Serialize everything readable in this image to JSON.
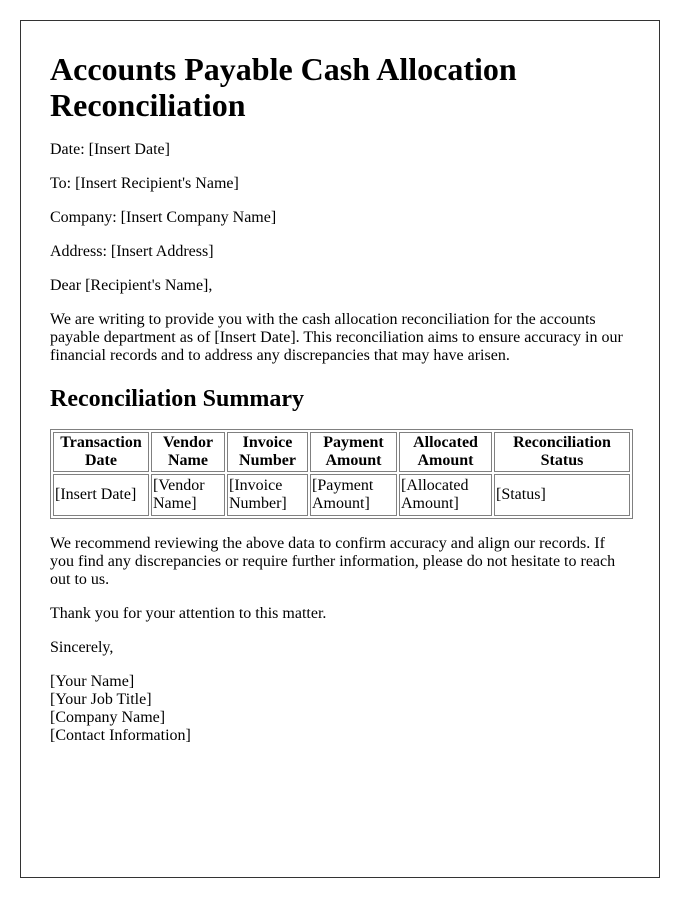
{
  "title": "Accounts Payable Cash Allocation Reconciliation",
  "fields": {
    "date": "Date: [Insert Date]",
    "to": "To: [Insert Recipient's Name]",
    "company": "Company: [Insert Company Name]",
    "address": "Address: [Insert Address]"
  },
  "salutation": "Dear [Recipient's Name],",
  "intro": "We are writing to provide you with the cash allocation reconciliation for the accounts payable department as of [Insert Date]. This reconciliation aims to ensure accuracy in our financial records and to address any discrepancies that may have arisen.",
  "summary": {
    "heading": "Reconciliation Summary",
    "columns": [
      "Transaction Date",
      "Vendor Name",
      "Invoice Number",
      "Payment Amount",
      "Allocated Amount",
      "Reconciliation Status"
    ],
    "rows": [
      [
        "[Insert Date]",
        "[Vendor Name]",
        "[Invoice Number]",
        "[Payment Amount]",
        "[Allocated Amount]",
        "[Status]"
      ]
    ]
  },
  "recommendation": "We recommend reviewing the above data to confirm accuracy and align our records. If you find any discrepancies or require further information, please do not hesitate to reach out to us.",
  "thanks": "Thank you for your attention to this matter.",
  "closing": "Sincerely,",
  "signature": [
    "[Your Name]",
    "[Your Job Title]",
    "[Company Name]",
    "[Contact Information]"
  ]
}
